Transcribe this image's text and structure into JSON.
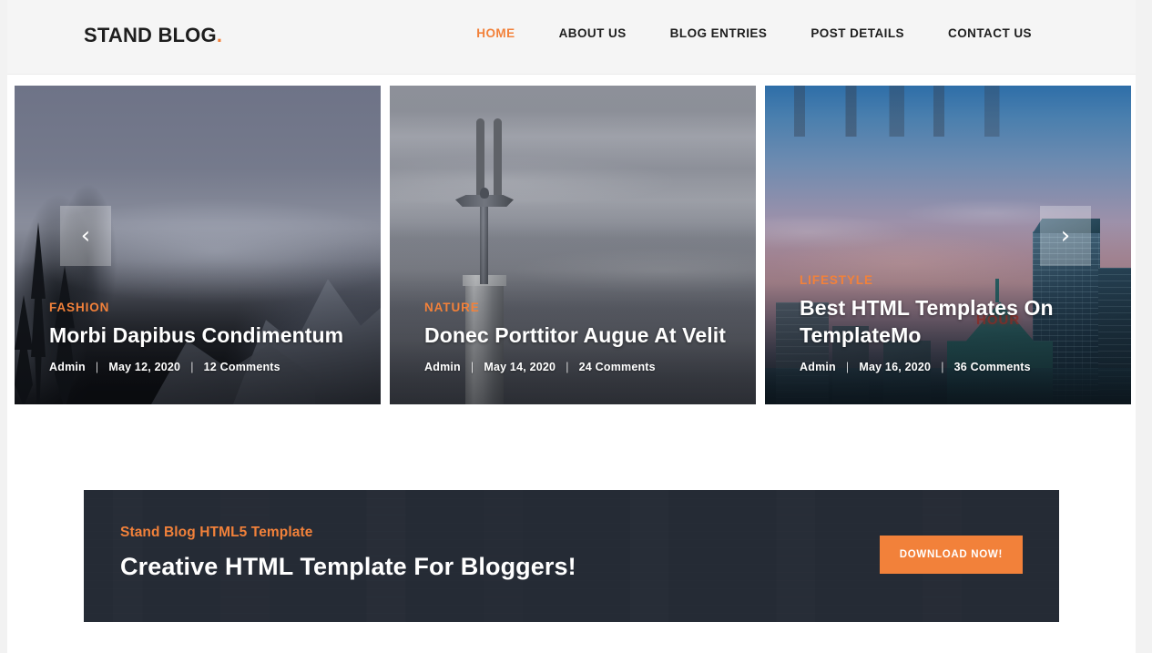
{
  "header": {
    "logo_text": "STAND BLOG",
    "logo_dot": ".",
    "nav": [
      {
        "label": "HOME",
        "active": true
      },
      {
        "label": "ABOUT US",
        "active": false
      },
      {
        "label": "BLOG ENTRIES",
        "active": false
      },
      {
        "label": "POST DETAILS",
        "active": false
      },
      {
        "label": "CONTACT US",
        "active": false
      }
    ]
  },
  "carousel": {
    "prev_icon": "‹",
    "next_icon": "›",
    "slides": [
      {
        "category": "FASHION",
        "title": "Morbi Dapibus Condimentum",
        "author": "Admin",
        "date": "May 12, 2020",
        "comments": "12 Comments",
        "separator": "|"
      },
      {
        "category": "NATURE",
        "title": "Donec Porttitor Augue At Velit",
        "author": "Admin",
        "date": "May 14, 2020",
        "comments": "24 Comments",
        "separator": "|"
      },
      {
        "category": "LIFESTYLE",
        "title": "Best HTML Templates On TemplateMo",
        "author": "Admin",
        "date": "May 16, 2020",
        "comments": "36 Comments",
        "separator": "|",
        "sign_text": "HOUR"
      }
    ]
  },
  "banner": {
    "subtitle": "Stand Blog HTML5 Template",
    "title": "Creative HTML Template For Bloggers!",
    "button_label": "Download Now!"
  },
  "colors": {
    "accent": "#f2813a",
    "header_bg": "#f5f5f5",
    "banner_bg": "#252b35",
    "text_dark": "#1e1e1e",
    "page_bg": "#f2f2f2"
  }
}
